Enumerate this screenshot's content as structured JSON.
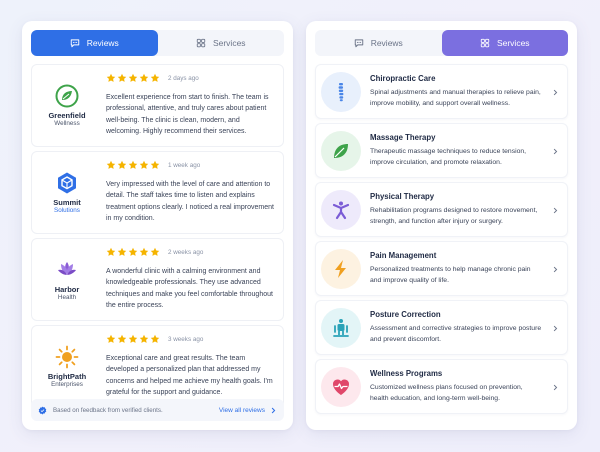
{
  "left_panel": {
    "tabs": [
      {
        "label": "Reviews",
        "active": true
      },
      {
        "label": "Services",
        "active": false
      }
    ],
    "reviews": [
      {
        "brand_name": "Greenfield",
        "brand_sub": "Wellness",
        "rating": 5,
        "when": "2 days ago",
        "text": "Excellent experience from start to finish. The team is professional, attentive, and truly cares about patient well-being. The clinic is clean, modern, and welcoming. Highly recommend their services.",
        "logo_icon": "leaf-circle-icon",
        "color": "#3ea34a"
      },
      {
        "brand_name": "Summit",
        "brand_sub": "Solutions",
        "rating": 5,
        "when": "1 week ago",
        "text": "Very impressed with the level of care and attention to detail. The staff takes time to listen and explains treatment options clearly. I noticed a real improvement in my condition.",
        "logo_icon": "hexagon-icon",
        "color": "#2f6fe6"
      },
      {
        "brand_name": "Harbor",
        "brand_sub": "Health",
        "rating": 5,
        "when": "2 weeks ago",
        "text": "A wonderful clinic with a calming environment and knowledgeable professionals. They use advanced techniques and make you feel comfortable throughout the entire process.",
        "logo_icon": "lotus-icon",
        "color": "#8b5cd6"
      },
      {
        "brand_name": "BrightPath",
        "brand_sub": "Enterprises",
        "rating": 5,
        "when": "3 weeks ago",
        "text": "Exceptional care and great results. The team developed a personalized plan that addressed my concerns and helped me achieve my health goals. I'm grateful for the support and guidance.",
        "logo_icon": "sun-icon",
        "color": "#f0a020"
      }
    ],
    "footer": {
      "note": "Based on feedback from verified clients.",
      "link": "View all reviews"
    }
  },
  "right_panel": {
    "tabs": [
      {
        "label": "Reviews",
        "active": false
      },
      {
        "label": "Services",
        "active": true
      }
    ],
    "services": [
      {
        "title": "Chiropractic Care",
        "desc": "Spinal adjustments and manual therapies to relieve pain, improve mobility, and support overall wellness.",
        "icon": "spine-icon",
        "color": "#4a86e8",
        "bg": "#e8f0fc"
      },
      {
        "title": "Massage Therapy",
        "desc": "Therapeutic massage techniques to reduce tension, improve circulation, and promote relaxation.",
        "icon": "leaf-icon",
        "color": "#3ea34a",
        "bg": "#e6f5e9"
      },
      {
        "title": "Physical Therapy",
        "desc": "Rehabilitation programs designed to restore movement, strength, and function after injury or surgery.",
        "icon": "person-stretch-icon",
        "color": "#7b5cd6",
        "bg": "#eeeafb"
      },
      {
        "title": "Pain Management",
        "desc": "Personalized treatments to help manage chronic pain and improve quality of life.",
        "icon": "lightning-icon",
        "color": "#f0a020",
        "bg": "#fdf2e1"
      },
      {
        "title": "Posture Correction",
        "desc": "Assessment and corrective strategies to improve posture and prevent discomfort.",
        "icon": "posture-icon",
        "color": "#2aa3b8",
        "bg": "#e3f5f7"
      },
      {
        "title": "Wellness Programs",
        "desc": "Customized wellness plans focused on prevention, health education, and long-term well-being.",
        "icon": "heart-pulse-icon",
        "color": "#e0476a",
        "bg": "#fde8ed"
      }
    ]
  },
  "colors": {
    "reviews_accent": "#2f6fe6",
    "services_accent": "#7b6fe0",
    "star": "#f5b400"
  }
}
